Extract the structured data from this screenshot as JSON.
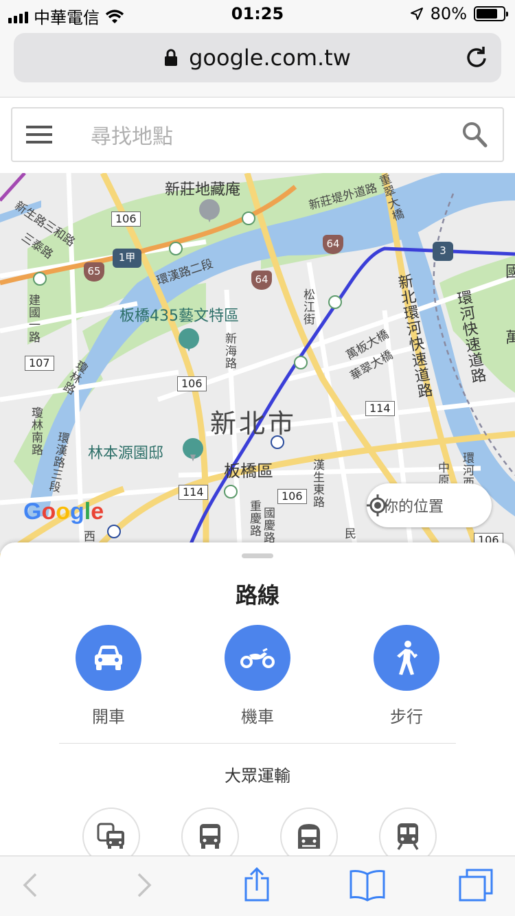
{
  "status_bar": {
    "carrier": "中華電信",
    "time": "01:25",
    "battery": "80%"
  },
  "browser": {
    "url": "google.com.tw"
  },
  "search": {
    "placeholder": "尋找地點"
  },
  "map": {
    "labels": {
      "xinzhuang_dizang": "新莊地藏庵",
      "banqiao_435": "板橋435藝文特區",
      "lin_garden": "林本源園邸",
      "city": "新北市",
      "district": "板橋區",
      "xinsheng_rd": "新生路",
      "sanhe_rd": "三和路",
      "santai_rd": "三泰路",
      "huanhan_rd": "環漢路二段",
      "jianguo_rd": "建國一路",
      "songjiang_st": "松江街",
      "xinhai_rd": "新海路",
      "wanban_bridge": "萬板大橋",
      "huacui_bridge": "華翠大橋",
      "chongcui_bridge": "重翠大橋",
      "xinbei_huanhe": "新北環河快速道路",
      "huanhe_express": "環河快速道路",
      "huanhe_rd_side": "環河西路",
      "xinzhuang_dike": "新莊堤外道路",
      "lin_rd": "瓊林路",
      "lin_rd2": "瓊林南路",
      "huanhan_rd3": "環漢路三段",
      "hansheng_e": "漢生東路",
      "chongqing_rd": "重慶路",
      "guoqing_rd": "國慶路",
      "zhongzheng_rd": "中原街",
      "huanhe_xi": "環河西路",
      "guo": "國",
      "wan": "萬",
      "min": "民",
      "xi": "西"
    },
    "shields": {
      "s106a": "106",
      "s106b": "106",
      "s106c": "106",
      "s106d": "106",
      "s107": "107",
      "s114a": "114",
      "s114b": "114",
      "h64a": "64",
      "h64b": "64",
      "h65": "65",
      "h1": "1甲",
      "h3": "3"
    },
    "google_logo": "Google",
    "my_location_label": "你的位置"
  },
  "sheet": {
    "title": "路線",
    "modes": [
      {
        "label": "開車",
        "icon": "car-icon"
      },
      {
        "label": "機車",
        "icon": "motorcycle-icon"
      },
      {
        "label": "步行",
        "icon": "walking-icon"
      }
    ],
    "transit_title": "大眾運輸",
    "transit_options": [
      "transit-mixed-icon",
      "bus-icon",
      "subway-icon",
      "train-icon"
    ]
  },
  "colors": {
    "accent_blue": "#4c84ec",
    "route_blue": "#3b3fd8",
    "river": "#9fc5eb",
    "park": "#c8e6b5"
  }
}
